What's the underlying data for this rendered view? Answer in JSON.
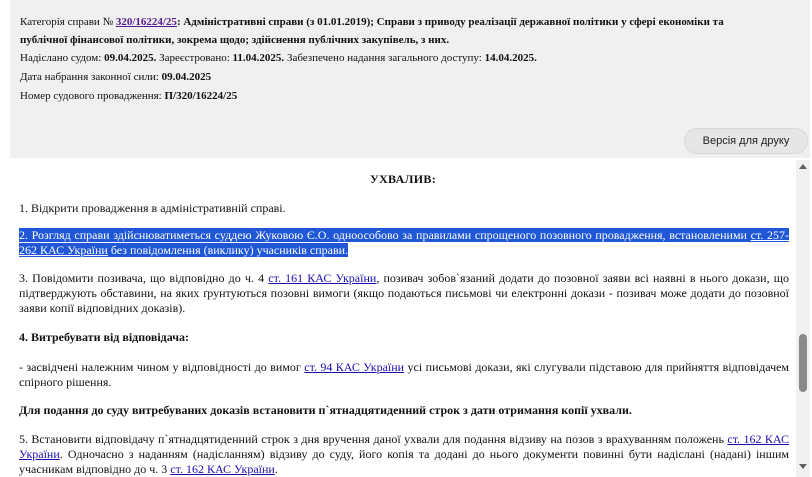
{
  "meta": {
    "category_label": "Категорія справи №",
    "case_number": "320/16224/25",
    "category_value": "Адміністративні справи (з 01.01.2019); Справи з приводу реалізації державної політики у сфері економіки та",
    "category_value_cont": "публічної фінансової політики, зокрема щодо; здійснення публічних закупівель, з них.",
    "sent_label": "Надіслано судом:",
    "sent_date": "09.04.2025.",
    "registered_label": "Зареєстровано:",
    "registered_date": "11.04.2025.",
    "access_label": "Забезпечено надання загального доступу:",
    "access_date": "14.04.2025.",
    "effective_label": "Дата набрання законної сили:",
    "effective_date": "09.04.2025",
    "proceeding_label": "Номер судового провадження:",
    "proceeding_number": "П/320/16224/25"
  },
  "toolbar": {
    "print_label": "Версія для друку"
  },
  "doc": {
    "heading": "УХВАЛИВ:",
    "p1": "1. Відкрити провадження в адміністративній справі.",
    "p2_a": "2. Розгляд справи здійснюватиметься суддею Жуковою Є.О. одноособово за правилами спрощеного позовного провадження, встановленими",
    "p2_link": "ст. 257-262 КАС України",
    "p2_b": "без повідомлення (виклику) учасників справи.",
    "p3_a": "3. Повідомити позивача, що відповідно до ч. 4",
    "p3_link": "ст. 161 КАС України",
    "p3_b": ", позивач зобов`язаний додати до позовної заяви всі наявні в нього докази, що підтверджують обставини, на яких ґрунтуються позовні вимоги (якщо подаються письмові чи електронні докази - позивач може додати до позовної заяви копії відповідних доказів).",
    "p4": "4. Витребувати від відповідача:",
    "p5_a": "- засвідчені належним чином у відповідності до вимог",
    "p5_link": "ст. 94 КАС України",
    "p5_b": "усі письмові докази, які слугували підставою для прийняття відповідачем спірного рішення.",
    "p6": "Для подання до суду витребуваних доказів встановити п`ятнадцятиденний строк з дати отримання копії ухвали.",
    "p7_a": "5. Встановити відповідачу п`ятнадцятиденний строк з дня вручення даної ухвали для подання відзиву на позов з врахуванням положень",
    "p7_link1": "ст. 162 КАС України",
    "p7_b": ". Одночасно з наданням (надісланням) відзиву до суду, його копія та додані до нього документи повинні бути надіслані (надані) іншим учасникам відповідно до ч. 3",
    "p7_link2": "ст. 162 КАС України",
    "p7_c": "."
  }
}
